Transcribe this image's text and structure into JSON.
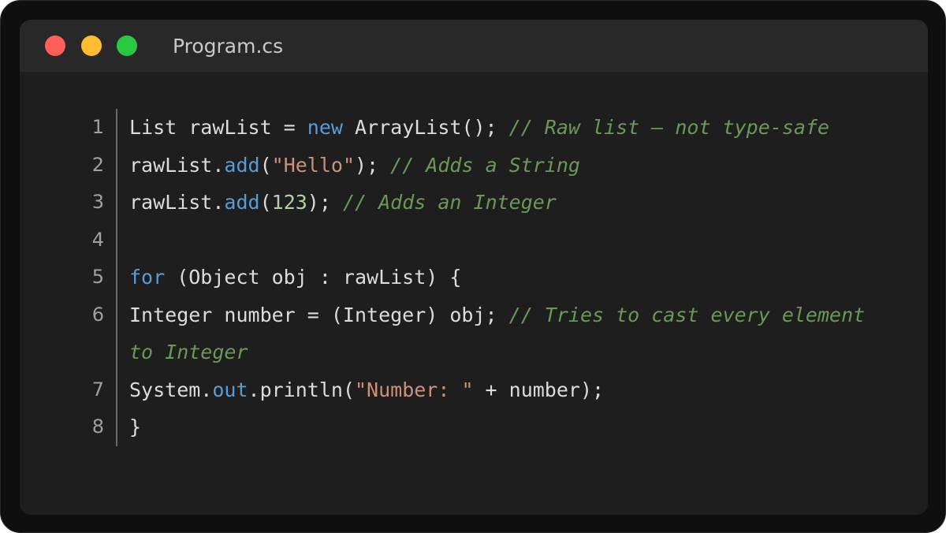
{
  "window": {
    "filename": "Program.cs",
    "colors": {
      "background": "#1e1e1e",
      "titlebar": "#282828",
      "close_dot": "#fe5f57",
      "minimize_dot": "#febc2e",
      "maximize_dot": "#28c840",
      "keyword": "#569cd6",
      "string": "#ce9178",
      "number": "#b5cea8",
      "comment": "#6a9955",
      "text": "#dcdcdc"
    }
  },
  "code": {
    "lines": [
      {
        "number": "1",
        "tokens": [
          {
            "type": "pl",
            "text": "List rawList = "
          },
          {
            "type": "kw",
            "text": "new"
          },
          {
            "type": "pl",
            "text": " ArrayList(); "
          },
          {
            "type": "cmt",
            "text": "// Raw list – not type-safe"
          }
        ]
      },
      {
        "number": "2",
        "tokens": [
          {
            "type": "pl",
            "text": "rawList."
          },
          {
            "type": "kw",
            "text": "add"
          },
          {
            "type": "pl",
            "text": "("
          },
          {
            "type": "str",
            "text": "\"Hello\""
          },
          {
            "type": "pl",
            "text": "); "
          },
          {
            "type": "cmt",
            "text": "// Adds a String"
          }
        ]
      },
      {
        "number": "3",
        "tokens": [
          {
            "type": "pl",
            "text": "rawList."
          },
          {
            "type": "kw",
            "text": "add"
          },
          {
            "type": "pl",
            "text": "("
          },
          {
            "type": "num",
            "text": "123"
          },
          {
            "type": "pl",
            "text": "); "
          },
          {
            "type": "cmt",
            "text": "// Adds an Integer"
          }
        ]
      },
      {
        "number": "4",
        "tokens": []
      },
      {
        "number": "5",
        "tokens": [
          {
            "type": "kw",
            "text": "for"
          },
          {
            "type": "pl",
            "text": " (Object obj : rawList) {"
          }
        ]
      },
      {
        "number": "6",
        "tokens": [
          {
            "type": "pl",
            "text": "Integer number = (Integer) obj; "
          },
          {
            "type": "cmt",
            "text": "// Tries to cast every element to Integer"
          }
        ]
      },
      {
        "number": "7",
        "tokens": [
          {
            "type": "pl",
            "text": "System."
          },
          {
            "type": "kw",
            "text": "out"
          },
          {
            "type": "pl",
            "text": ".println("
          },
          {
            "type": "str",
            "text": "\"Number: \""
          },
          {
            "type": "pl",
            "text": " + number);"
          }
        ]
      },
      {
        "number": "8",
        "tokens": [
          {
            "type": "pl",
            "text": "}"
          }
        ]
      }
    ]
  }
}
